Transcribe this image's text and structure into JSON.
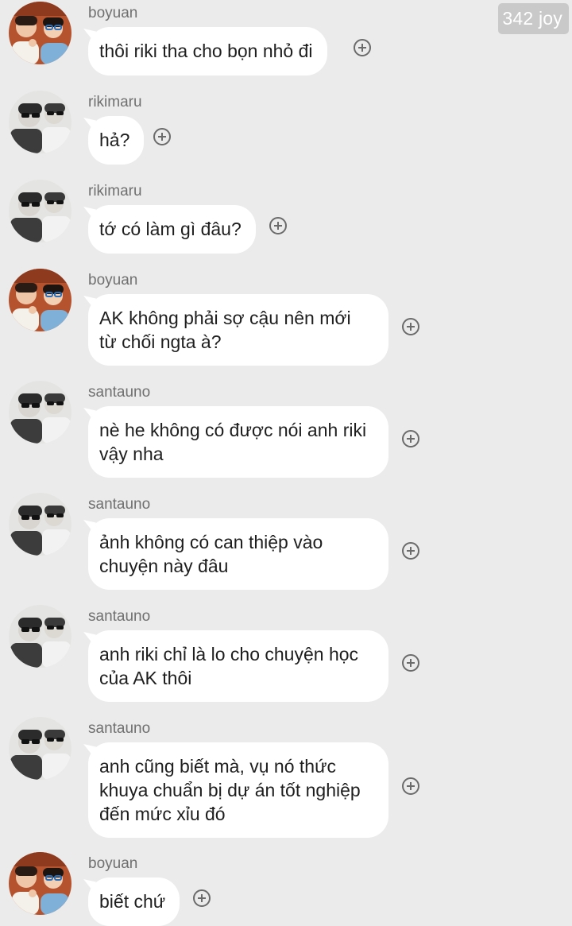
{
  "watermark": "342 joy",
  "colors": {
    "background": "#ebebeb",
    "bubble": "#ffffff",
    "name": "#707070",
    "text": "#1e1e1e",
    "watermark_bg": "#c9c9c9"
  },
  "messages": [
    {
      "sender": "boyuan",
      "avatar": "avatar-boyuan",
      "text": "thôi riki tha cho bọn nhỏ đi"
    },
    {
      "sender": "rikimaru",
      "avatar": "avatar-riki",
      "text": "hả?"
    },
    {
      "sender": "rikimaru",
      "avatar": "avatar-riki",
      "text": "tớ có làm gì đâu?"
    },
    {
      "sender": "boyuan",
      "avatar": "avatar-boyuan",
      "text": "AK không phải sợ cậu nên mới\ntừ chối ngta à?"
    },
    {
      "sender": "santauno",
      "avatar": "avatar-santa",
      "text": "nè he không có được nói anh riki\nvậy nha"
    },
    {
      "sender": "santauno",
      "avatar": "avatar-santa",
      "text": "ảnh không có can thiệp vào\nchuyện này đâu"
    },
    {
      "sender": "santauno",
      "avatar": "avatar-santa",
      "text": "anh riki chỉ là lo cho chuyện học\ncủa AK thôi"
    },
    {
      "sender": "santauno",
      "avatar": "avatar-santa",
      "text": "anh cũng biết mà, vụ nó thức\nkhuya chuẩn bị dự án tốt nghiệp\nđến mức xỉu đó"
    },
    {
      "sender": "boyuan",
      "avatar": "avatar-boyuan",
      "text": "biết chứ"
    }
  ]
}
